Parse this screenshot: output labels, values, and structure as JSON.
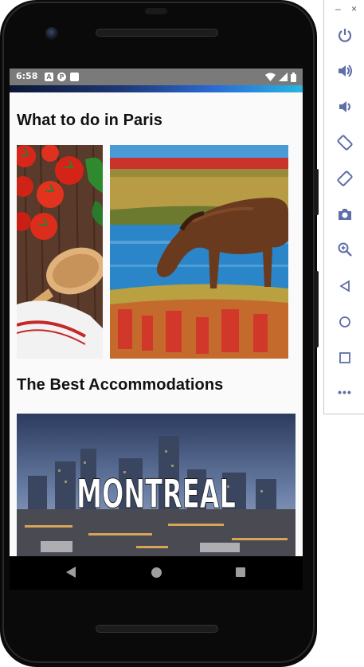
{
  "statusbar": {
    "time": "6:58",
    "icons": [
      "a-badge-icon",
      "p-badge-icon",
      "sd-card-icon"
    ],
    "right_icons": [
      "wifi-icon",
      "signal-icon",
      "battery-icon"
    ]
  },
  "sections": {
    "paris_title": "What to do in Paris",
    "accommodations_title": "The Best Accommodations"
  },
  "images": {
    "food": "tomatoes-and-wooden-spoon-image",
    "horse": "horse-grazing-image",
    "city": "montreal-city-image",
    "city_overlay_text": "MONTREAL"
  },
  "navbar": {
    "back": "back-icon",
    "home": "home-icon",
    "recents": "recents-icon"
  },
  "emulator_panel": {
    "window_controls": [
      "–",
      "×"
    ],
    "buttons": [
      "power-icon",
      "volume-up-icon",
      "volume-down-icon",
      "rotate-left-icon",
      "rotate-right-icon",
      "camera-icon",
      "zoom-icon",
      "back-icon",
      "home-icon",
      "overview-icon"
    ],
    "more": "•••"
  },
  "colors": {
    "statusbar": "#7a7a7a",
    "screen_bg": "#fafafa",
    "title_text": "#111111",
    "emu_icon": "#5f6ea8"
  }
}
